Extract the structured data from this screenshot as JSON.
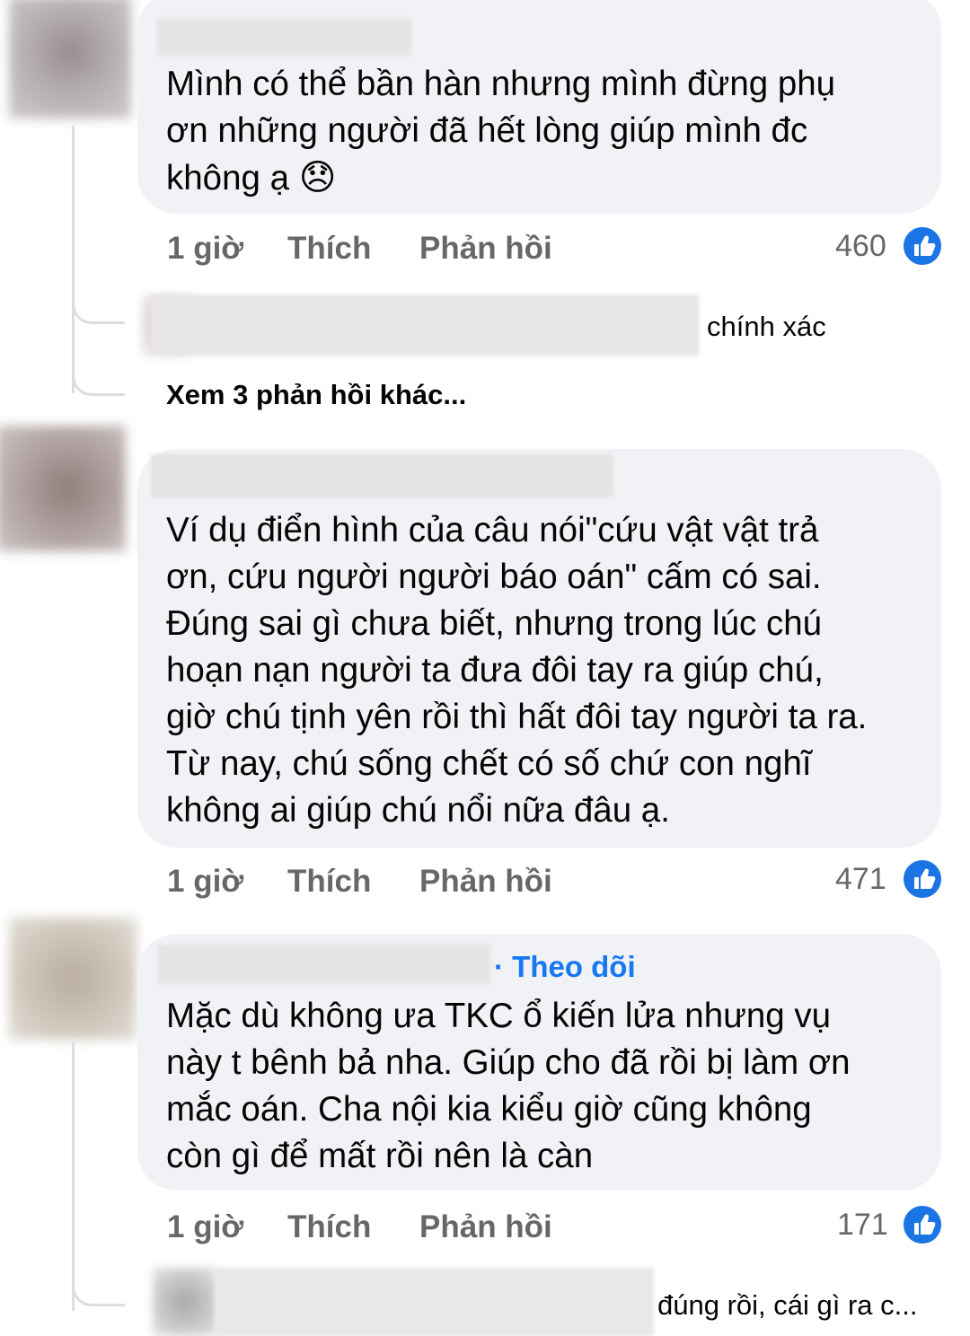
{
  "colors": {
    "bubble": "#f0f2f5",
    "meta_text": "#65676b",
    "accent_blue": "#1877f2",
    "like_blue": "#1b74e4"
  },
  "comments": [
    {
      "text": "Mình có thể bần hàn nhưng mình đừng phụ\nơn những người đã hết lòng giúp mình đc\nkhông ạ",
      "emoji": "😞",
      "time": "1 giờ",
      "like_label": "Thích",
      "reply_label": "Phản hồi",
      "reactions": "460",
      "replies": [
        {
          "text": "chính xác"
        }
      ],
      "more_replies": "Xem 3 phản hồi khác..."
    },
    {
      "text": "Ví dụ điển hình của câu nói\"cứu vật vật trả\nơn, cứu người người báo oán\" cấm có sai.\nĐúng sai gì chưa biết, nhưng trong lúc chú\nhoạn nạn người ta đưa đôi tay ra giúp chú,\ngiờ chú tịnh yên rồi thì hất đôi tay người ta ra.\nTừ nay, chú sống chết có số chứ con nghĩ\nkhông ai giúp chú nổi nữa đâu ạ.",
      "time": "1 giờ",
      "like_label": "Thích",
      "reply_label": "Phản hồi",
      "reactions": "471"
    },
    {
      "follow_label": "· Theo dõi",
      "text": "Mặc dù không ưa TKC ổ kiến lửa nhưng vụ\nnày t bênh bả nha. Giúp cho đã rồi bị làm ơn\nmắc oán. Cha nội kia kiểu giờ cũng không\ncòn gì để mất rồi nên là càn",
      "time": "1 giờ",
      "like_label": "Thích",
      "reply_label": "Phản hồi",
      "reactions": "171",
      "replies": [
        {
          "text": "đúng rồi, cái gì ra c..."
        }
      ]
    }
  ]
}
